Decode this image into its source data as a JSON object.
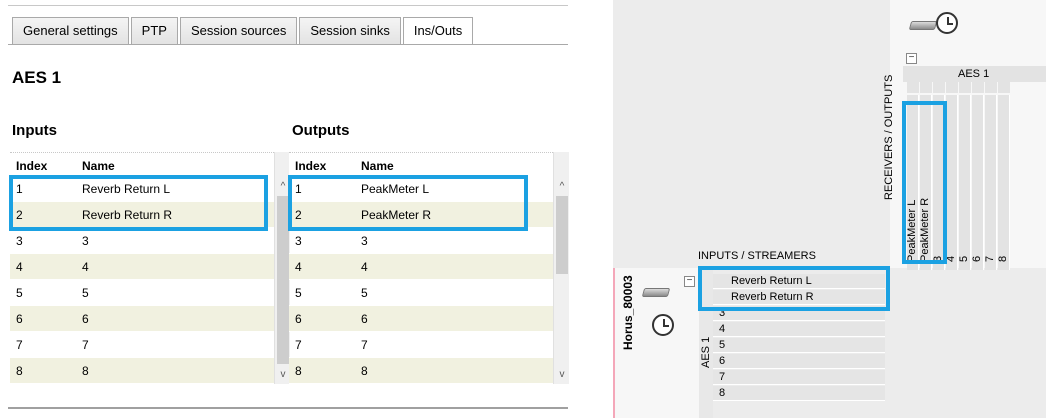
{
  "tabs": [
    "General settings",
    "PTP",
    "Session sources",
    "Session sinks",
    "Ins/Outs"
  ],
  "active_tab": "Ins/Outs",
  "section_title": "AES 1",
  "inputs": {
    "title": "Inputs",
    "columns": [
      "Index",
      "Name"
    ],
    "rows": [
      {
        "index": "1",
        "name": "Reverb Return L"
      },
      {
        "index": "2",
        "name": "Reverb Return R"
      },
      {
        "index": "3",
        "name": "3"
      },
      {
        "index": "4",
        "name": "4"
      },
      {
        "index": "5",
        "name": "5"
      },
      {
        "index": "6",
        "name": "6"
      },
      {
        "index": "7",
        "name": "7"
      },
      {
        "index": "8",
        "name": "8"
      }
    ]
  },
  "outputs": {
    "title": "Outputs",
    "columns": [
      "Index",
      "Name"
    ],
    "rows": [
      {
        "index": "1",
        "name": "PeakMeter L"
      },
      {
        "index": "2",
        "name": "PeakMeter R"
      },
      {
        "index": "3",
        "name": "3"
      },
      {
        "index": "4",
        "name": "4"
      },
      {
        "index": "5",
        "name": "5"
      },
      {
        "index": "6",
        "name": "6"
      },
      {
        "index": "7",
        "name": "7"
      },
      {
        "index": "8",
        "name": "8"
      }
    ]
  },
  "matrix": {
    "receivers_label": "RECEIVERS / OUTPUTS",
    "inputs_label": "INPUTS / STREAMERS",
    "top_group": "AES 1",
    "device_name": "Horus_80003",
    "side_group": "AES 1",
    "columns": [
      "PeakMeter L",
      "PeakMeter R",
      "3",
      "4",
      "5",
      "6",
      "7",
      "8"
    ],
    "rows": [
      "Reverb Return L",
      "Reverb Return R",
      "3",
      "4",
      "5",
      "6",
      "7",
      "8"
    ],
    "collapse_symbol": "−"
  },
  "colors": {
    "highlight": "#1ba1e2",
    "alt_row": "#f1f1e0",
    "device_accent": "#f4a7b9"
  },
  "scroll_up_glyph": "^",
  "scroll_down_glyph": "v"
}
